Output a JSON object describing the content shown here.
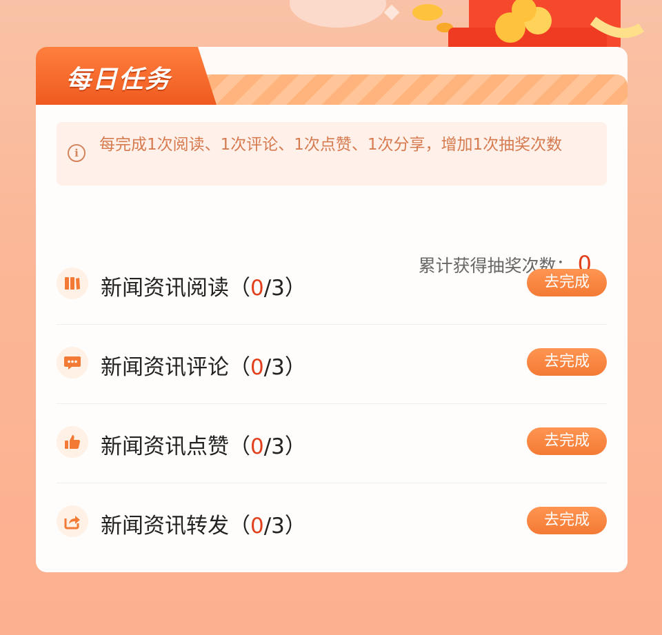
{
  "header": {
    "title": "每日任务"
  },
  "notice": {
    "text": "每完成1次阅读、1次评论、1次点赞、1次分享，增加1次抽奖次数"
  },
  "total": {
    "label": "累计获得抽奖次数：",
    "value": "0"
  },
  "colors": {
    "accent": "#f37a34",
    "highlight": "#e2401c",
    "notice_bg": "#fff1ea"
  },
  "tasks": [
    {
      "name": "新闻资讯阅读",
      "open": "（",
      "done": "0",
      "rest": "/3）",
      "button": "去完成",
      "icon": "book-icon"
    },
    {
      "name": "新闻资讯评论",
      "open": "（",
      "done": "0",
      "rest": "/3）",
      "button": "去完成",
      "icon": "comment-icon"
    },
    {
      "name": "新闻资讯点赞",
      "open": "（",
      "done": "0",
      "rest": "/3）",
      "button": "去完成",
      "icon": "thumbs-up-icon"
    },
    {
      "name": "新闻资讯转发",
      "open": "（",
      "done": "0",
      "rest": "/3）",
      "button": "去完成",
      "icon": "share-icon"
    }
  ]
}
